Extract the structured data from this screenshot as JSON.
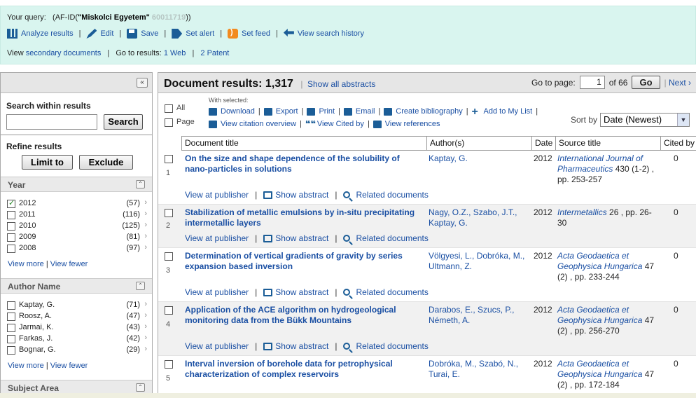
{
  "query": {
    "label": "Your query:",
    "prefix": "(AF-ID(",
    "name": "\"Miskolci Egyetem\"",
    "id": "60011719",
    "suffix": "))"
  },
  "actions": [
    "Analyze results",
    "Edit",
    "Save",
    "Set alert",
    "Set feed",
    "View search history"
  ],
  "view_row": {
    "view": "View",
    "secondary": "secondary documents",
    "goto": "Go to results:",
    "web": "1 Web",
    "patent": "2 Patent"
  },
  "sidebar": {
    "collapse": "«",
    "search_within_title": "Search within results",
    "search_input_value": "",
    "search_button": "Search",
    "refine_title": "Refine results",
    "limit_button": "Limit to",
    "exclude_button": "Exclude",
    "year_facet": {
      "title": "Year",
      "items": [
        {
          "label": "2012",
          "count": "(57)",
          "checked": true
        },
        {
          "label": "2011",
          "count": "(116)",
          "checked": false
        },
        {
          "label": "2010",
          "count": "(125)",
          "checked": false
        },
        {
          "label": "2009",
          "count": "(81)",
          "checked": false
        },
        {
          "label": "2008",
          "count": "(97)",
          "checked": false
        }
      ],
      "view_more": "View more",
      "view_fewer": "View fewer"
    },
    "author_facet": {
      "title": "Author Name",
      "items": [
        {
          "label": "Kaptay, G.",
          "count": "(71)",
          "checked": false
        },
        {
          "label": "Roosz, A.",
          "count": "(47)",
          "checked": false
        },
        {
          "label": "Jarmai, K.",
          "count": "(43)",
          "checked": false
        },
        {
          "label": "Farkas, J.",
          "count": "(42)",
          "checked": false
        },
        {
          "label": "Bognar, G.",
          "count": "(29)",
          "checked": false
        }
      ],
      "view_more": "View more",
      "view_fewer": "View fewer"
    },
    "subject_facet": {
      "title": "Subject Area"
    }
  },
  "results": {
    "title": "Document results: 1,317",
    "show_abstracts": "Show all abstracts",
    "goto_label": "Go to page:",
    "page_value": "1",
    "of_pages": "of 66",
    "go_button": "Go",
    "next": "Next ›",
    "select_all": "All",
    "select_page": "Page",
    "with_selected": "With selected:",
    "tools_row1": [
      "Download",
      "Export",
      "Print",
      "Email",
      "Create bibliography",
      "Add to My List"
    ],
    "tools_row2": [
      "View citation overview",
      "View Cited by",
      "View references"
    ],
    "sort_label": "Sort by",
    "sort_value": "Date (Newest)",
    "columns": [
      "Document title",
      "Author(s)",
      "Date",
      "Source title",
      "Cited by"
    ],
    "link_labels": {
      "publisher": "View at publisher",
      "abstract": "Show abstract",
      "related": "Related documents"
    },
    "rows": [
      {
        "num": "1",
        "title": "On the size and shape dependence of the solubility of nano-particles in solutions",
        "authors": "Kaptay, G.",
        "year": "2012",
        "source_title": "International Journal of Pharmaceutics",
        "source_rest": " 430 (1-2) , pp. 253-257",
        "cited": "0"
      },
      {
        "num": "2",
        "title": "Stabilization of metallic emulsions by in-situ precipitating intermetallic layers",
        "authors": "Nagy, O.Z., Szabo, J.T., Kaptay, G.",
        "year": "2012",
        "source_title": "Intermetallics",
        "source_rest": " 26 , pp. 26-30",
        "cited": "0"
      },
      {
        "num": "3",
        "title": "Determination of vertical gradients of gravity by series expansion based inversion",
        "authors": "Völgyesi, L., Dobróka, M., Ultmann, Z.",
        "year": "2012",
        "source_title": "Acta Geodaetica et Geophysica Hungarica",
        "source_rest": " 47 (2) , pp. 233-244",
        "cited": "0"
      },
      {
        "num": "4",
        "title": "Application of the ACE algorithm on hydrogeological monitoring data from the Bükk Mountains",
        "authors": "Darabos, E., Szucs, P., Németh, A.",
        "year": "2012",
        "source_title": "Acta Geodaetica et Geophysica Hungarica",
        "source_rest": " 47 (2) , pp. 256-270",
        "cited": "0"
      },
      {
        "num": "5",
        "title": "Interval inversion of borehole data for petrophysical characterization of complex reservoirs",
        "authors": "Dobróka, M., Szabó, N., Turai, E.",
        "year": "2012",
        "source_title": "Acta Geodaetica et Geophysica Hungarica",
        "source_rest": " 47 (2) , pp. 172-184",
        "cited": "0"
      }
    ]
  }
}
